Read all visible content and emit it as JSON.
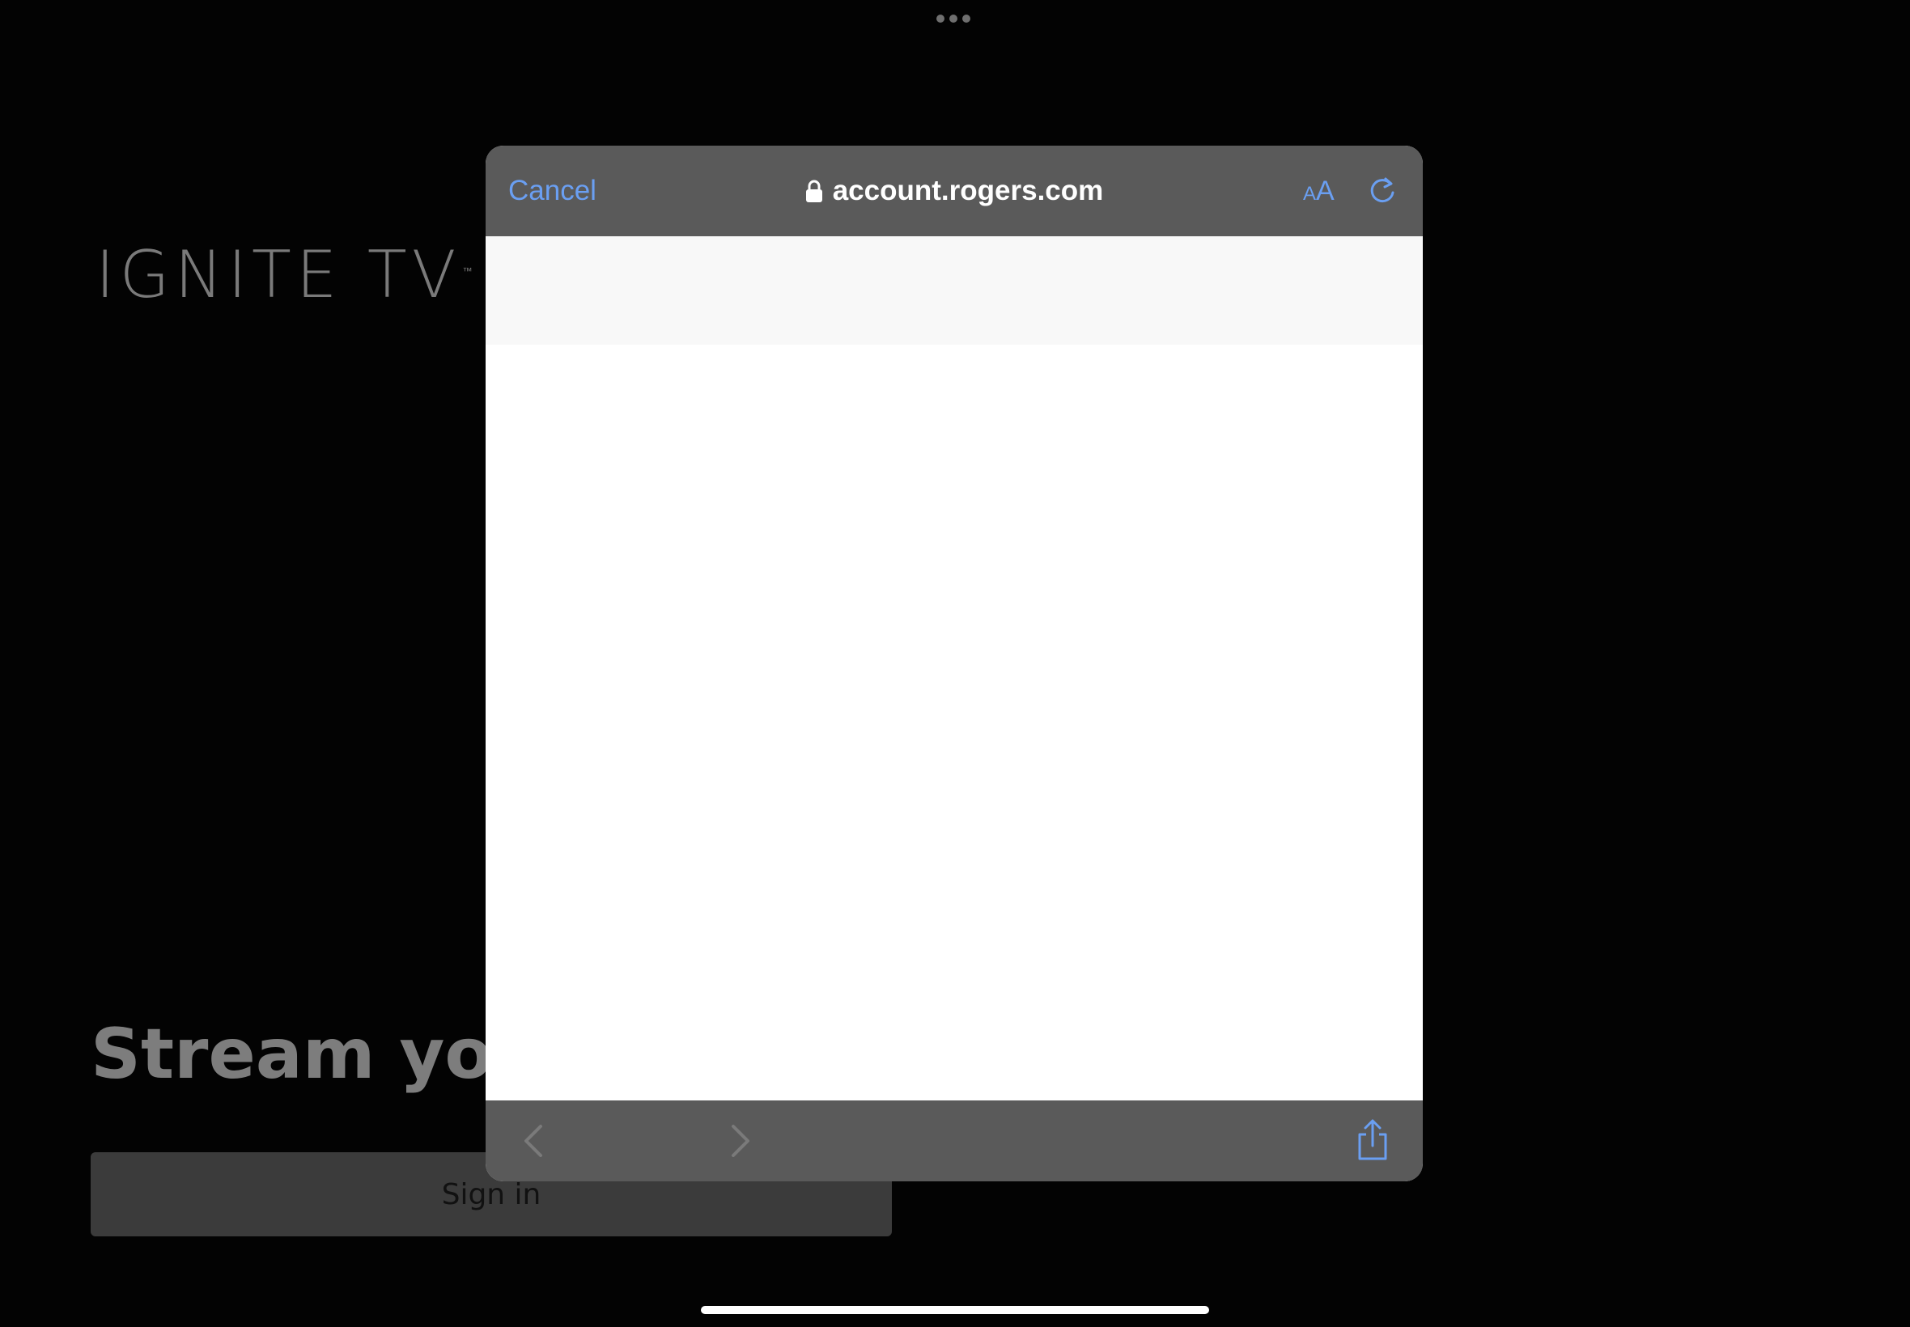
{
  "background_app": {
    "brand": "IGNITE TV",
    "brand_mark": "™",
    "headline": "Stream your",
    "signin_label": "Sign in"
  },
  "browser_sheet": {
    "cancel_label": "Cancel",
    "url": "account.rogers.com",
    "text_size_label_small": "A",
    "text_size_label_big": "A",
    "colors": {
      "accent": "#6a9ff2",
      "toolbar": "#5a5a5a"
    }
  },
  "icons": {
    "lock": "lock-icon",
    "reload": "reload-icon",
    "back": "chevron-left-icon",
    "forward": "chevron-right-icon",
    "share": "share-icon"
  }
}
